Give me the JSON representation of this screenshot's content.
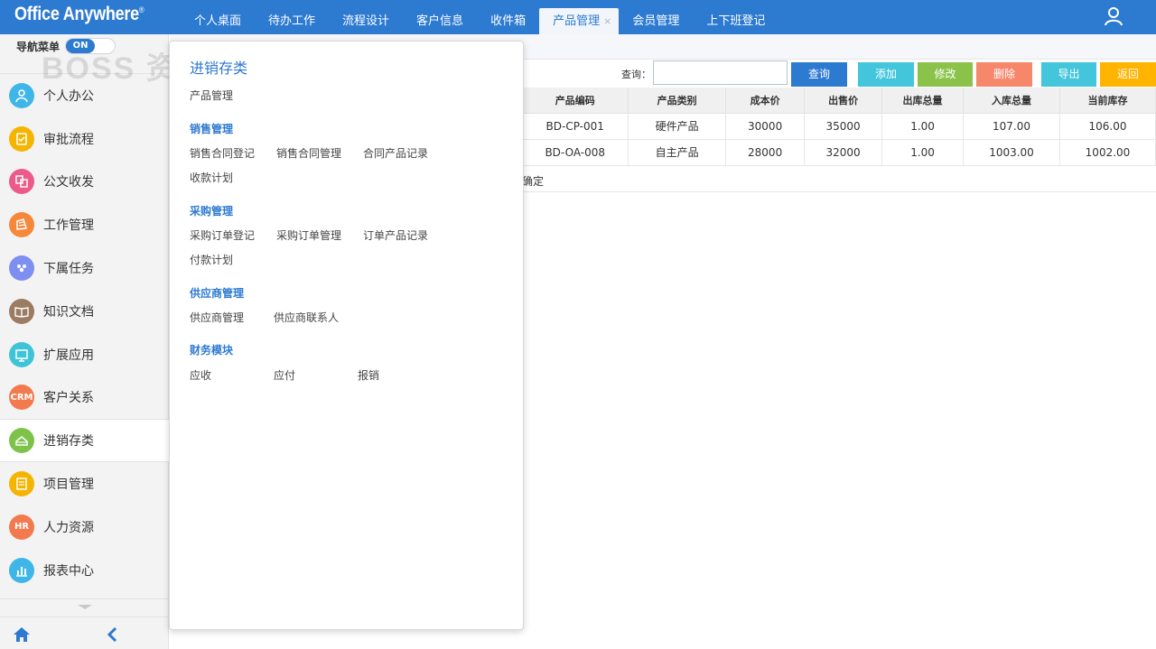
{
  "app": {
    "logo": "Office Anywhere",
    "logo_mark": "®"
  },
  "top_nav": [
    {
      "label": "个人桌面"
    },
    {
      "label": "待办工作"
    },
    {
      "label": "流程设计"
    },
    {
      "label": "客户信息"
    },
    {
      "label": "收件箱"
    },
    {
      "label": "产品管理",
      "active": true,
      "close": "×"
    },
    {
      "label": "会员管理"
    },
    {
      "label": "上下班登记"
    }
  ],
  "sidebar": {
    "nav_toggle_label": "导航菜单",
    "nav_toggle_state": "ON",
    "watermark": "BOSS 资源",
    "items": [
      {
        "label": "个人办公",
        "icon": "person-icon",
        "color": "#3fb6e8",
        "glyph": ""
      },
      {
        "label": "审批流程",
        "icon": "approval-icon",
        "color": "#f5b400",
        "glyph": ""
      },
      {
        "label": "公文收发",
        "icon": "document-exchange-icon",
        "color": "#ec5a8a",
        "glyph": ""
      },
      {
        "label": "工作管理",
        "icon": "work-icon",
        "color": "#f5883a",
        "glyph": ""
      },
      {
        "label": "下属任务",
        "icon": "team-icon",
        "color": "#7d8ff0",
        "glyph": ""
      },
      {
        "label": "知识文档",
        "icon": "book-icon",
        "color": "#9b7b62",
        "glyph": ""
      },
      {
        "label": "扩展应用",
        "icon": "extension-icon",
        "color": "#3fc3d8",
        "glyph": ""
      },
      {
        "label": "客户关系",
        "icon": "crm-icon",
        "color": "#f37a4e",
        "glyph": "CRM"
      },
      {
        "label": "进销存类",
        "icon": "inventory-icon",
        "color": "#7ec24a",
        "glyph": "",
        "active": true
      },
      {
        "label": "项目管理",
        "icon": "project-icon",
        "color": "#f5b400",
        "glyph": ""
      },
      {
        "label": "人力资源",
        "icon": "hr-icon",
        "color": "#f37a4e",
        "glyph": "HR"
      },
      {
        "label": "报表中心",
        "icon": "report-chart-icon",
        "color": "#3fb6e8",
        "glyph": ""
      }
    ]
  },
  "toolbar": {
    "search_label": "查询：",
    "search_value": "",
    "search_button": "查询",
    "add_button": "添加",
    "edit_button": "修改",
    "delete_button": "删除",
    "export_button": "导出",
    "back_button": "返回",
    "colors": {
      "search": "#2d7ad1",
      "add": "#43c6db",
      "edit": "#8bc34a",
      "delete": "#f7876b",
      "export": "#43c6db",
      "back": "#ffb400"
    }
  },
  "table": {
    "headers": [
      "产品编码",
      "产品类别",
      "成本价",
      "出售价",
      "出库总量",
      "入库总量",
      "当前库存"
    ],
    "rows": [
      [
        "BD-CP-001",
        "硬件产品",
        "30000",
        "35000",
        "1.00",
        "107.00",
        "106.00"
      ],
      [
        "BD-OA-008",
        "自主产品",
        "28000",
        "32000",
        "1.00",
        "1003.00",
        "1002.00"
      ]
    ],
    "footer_text": "确定"
  },
  "popup": {
    "title": "进销存类",
    "top_link": "产品管理",
    "sections": [
      {
        "title": "销售管理",
        "links": [
          "销售合同登记",
          "销售合同管理",
          "合同产品记录",
          "收款计划"
        ]
      },
      {
        "title": "采购管理",
        "links": [
          "采购订单登记",
          "采购订单管理",
          "订单产品记录",
          "付款计划"
        ]
      },
      {
        "title": "供应商管理",
        "links": [
          "供应商管理",
          "供应商联系人"
        ]
      },
      {
        "title": "财务模块",
        "links": [
          "应收",
          "应付",
          "报销"
        ]
      }
    ]
  }
}
